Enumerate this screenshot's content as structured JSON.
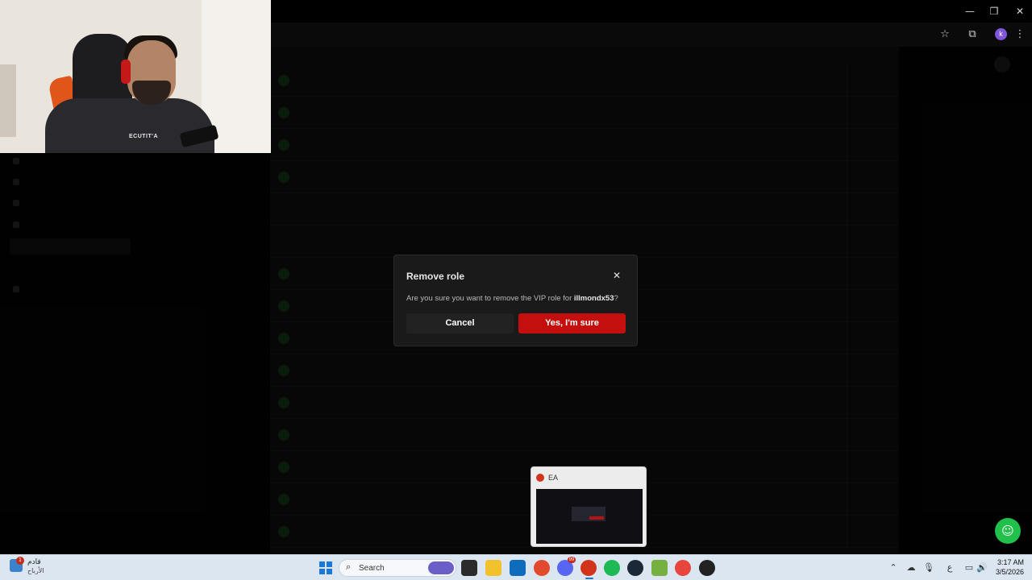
{
  "window": {
    "controls": {
      "minimize": "—",
      "restore": "❐",
      "close": "✕"
    }
  },
  "toolbar": {
    "bookmark_icon": "star-icon",
    "extensions_icon": "puzzle-icon",
    "profile_initial": "k",
    "menu_icon": "kebab-menu-icon"
  },
  "webcam": {
    "hoodie_text": "ECUTIT'A"
  },
  "modal": {
    "title": "Remove role",
    "body_prefix": "Are you sure you want to remove the VIP role for ",
    "username": "illmondx53",
    "body_suffix": "?",
    "cancel_label": "Cancel",
    "confirm_label": "Yes, I'm sure",
    "confirm_color": "#c40f0f"
  },
  "preview": {
    "title": "EA"
  },
  "taskbar": {
    "weather_line1": "قادم",
    "weather_line2": "الأرباح",
    "weather_badge": "1",
    "search_placeholder": "Search",
    "discord_badge": "99",
    "lang": "ع",
    "time": "3:17 AM",
    "date": "3/5/2026"
  },
  "colors": {
    "accent_red": "#c40f0f",
    "support_green": "#20c04a",
    "taskbar": "#dce6f1"
  }
}
